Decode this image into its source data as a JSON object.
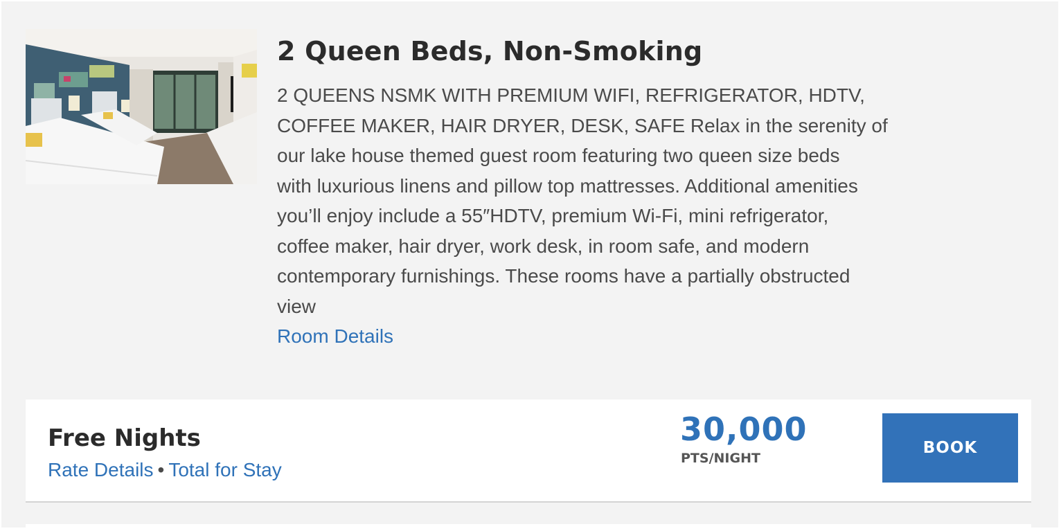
{
  "room": {
    "image_alt": "Hotel room with two queen beds",
    "title": "2 Queen Beds, Non-Smoking",
    "description_lines": [
      "2 QUEENS NSMK WITH PREMIUM WIFI, REFRIGERATOR, HDTV,",
      "COFFEE MAKER, HAIR DRYER, DESK, SAFE Relax in the serenity of",
      "our lake house themed guest room featuring two queen size beds",
      "with luxurious linens and pillow top mattresses. Additional amenities",
      "you’ll enjoy include a 55″HDTV, premium Wi-Fi, mini refrigerator,",
      "coffee maker, hair dryer, work desk, in room safe, and modern",
      "contemporary furnishings. These rooms have a partially obstructed",
      "view"
    ],
    "details_link": "Room Details"
  },
  "rate": {
    "name": "Free Nights",
    "rate_details_link": "Rate Details",
    "separator": "•",
    "total_link": "Total for Stay",
    "points": "30,000",
    "points_unit": "PTS/NIGHT",
    "book_label": "BOOK"
  },
  "colors": {
    "link": "#2f72b8",
    "button": "#3272b9",
    "background": "#f3f3f3"
  }
}
